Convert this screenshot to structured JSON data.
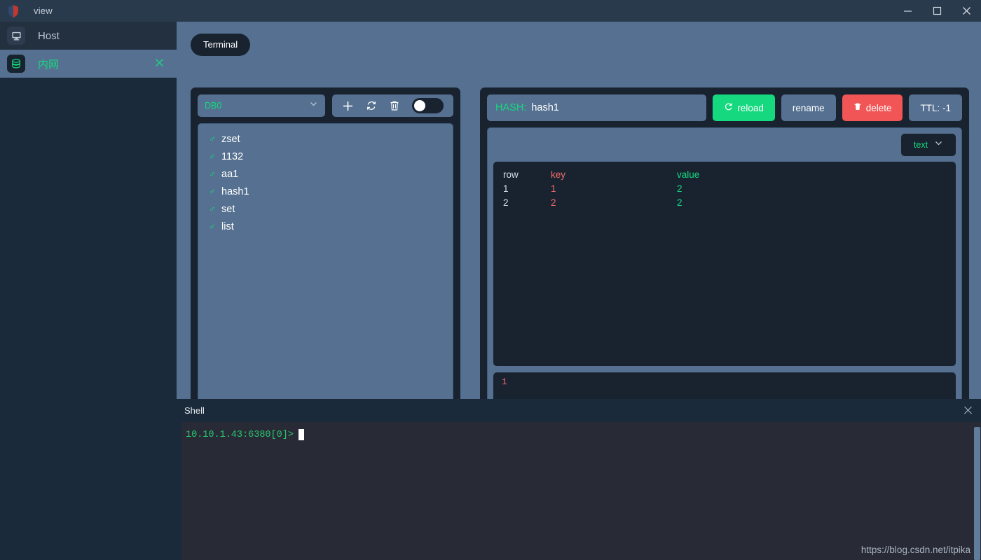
{
  "titlebar": {
    "logo_icon": "shield-icon",
    "title": "view",
    "minimize_icon": "minimize-icon",
    "maximize_icon": "maximize-icon",
    "close_icon": "close-icon"
  },
  "sidebar": {
    "items": [
      {
        "label": "Host",
        "icon": "monitor-icon",
        "active": false
      },
      {
        "label": "内网",
        "icon": "database-icon",
        "active": true,
        "close_icon": "close-icon"
      }
    ]
  },
  "tabs": [
    {
      "label": "Terminal",
      "active": true
    }
  ],
  "keypane": {
    "db_selected": "DB0",
    "db_chevron_icon": "chevron-down-icon",
    "buttons": [
      {
        "name": "add-key-button",
        "icon": "plus-icon"
      },
      {
        "name": "refresh-keys-button",
        "icon": "refresh-icon"
      },
      {
        "name": "delete-key-button",
        "icon": "trash-icon"
      }
    ],
    "toggle": {
      "name": "auto-refresh-toggle",
      "state": "off"
    },
    "keys": [
      {
        "icon": "key-icon",
        "name": "zset"
      },
      {
        "icon": "key-icon",
        "name": "1132"
      },
      {
        "icon": "key-icon",
        "name": "aa1"
      },
      {
        "icon": "key-icon",
        "name": "hash1"
      },
      {
        "icon": "key-icon",
        "name": "set"
      },
      {
        "icon": "key-icon",
        "name": "list"
      }
    ]
  },
  "valuepane": {
    "key_type_label": "HASH:",
    "key_name": "hash1",
    "reload_label": "reload",
    "reload_icon": "refresh-icon",
    "rename_label": "rename",
    "delete_label": "delete",
    "delete_icon": "trash-icon",
    "ttl_label": "TTL: -1",
    "view_format": "text",
    "view_format_chevron_icon": "chevron-down-icon",
    "table": {
      "columns": [
        "row",
        "key",
        "value"
      ],
      "rows": [
        [
          "1",
          "1",
          "2"
        ],
        [
          "2",
          "2",
          "2"
        ]
      ]
    },
    "editor_key_value": "1",
    "editor_value_value": "-"
  },
  "shell": {
    "title": "Shell",
    "close_icon": "close-icon",
    "prompt": "10.10.1.43:6380[0]>",
    "cursor": "block-cursor"
  },
  "watermark": "https://blog.csdn.net/itpika",
  "colors": {
    "background": "#557090",
    "panel": "#18232f",
    "sidebar": "#1b2a3a",
    "accent_green": "#16d97f",
    "accent_red": "#f25555",
    "key_red": "#f26a6a",
    "terminal_bg": "#282a36"
  }
}
